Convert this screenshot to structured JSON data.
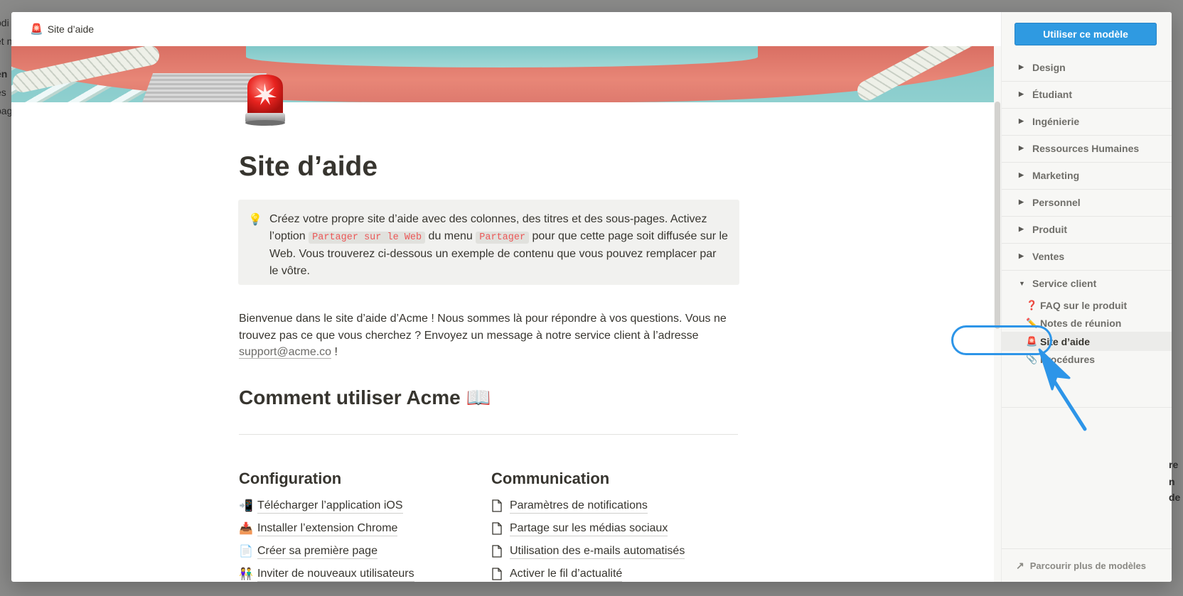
{
  "page": {
    "tab_title": "Site d’aide",
    "tab_emoji": "🚨",
    "title": "Site d’aide",
    "callout": {
      "emoji": "💡",
      "text_1": "Créez votre propre site d’aide avec des colonnes, des titres et des sous-pages. Activez l’option ",
      "code_1": "Partager sur le Web",
      "text_2": " du menu ",
      "code_2": "Partager",
      "text_3": " pour que cette page soit diffusée sur le Web. Vous trouverez ci-dessous un exemple de contenu que vous pouvez remplacer par le vôtre."
    },
    "intro": {
      "text": "Bienvenue dans le site d’aide d’Acme ! Nous sommes là pour répondre à vos questions. Vous ne trouvez pas ce que vous cherchez ? Envoyez un message à notre service client à l’adresse ",
      "email": "support@acme.co",
      "suffix": " !"
    },
    "section_heading": "Comment utiliser Acme 📖",
    "columns": [
      {
        "heading": "Configuration",
        "items": [
          {
            "icon": "📲",
            "label": "Télécharger l’application iOS"
          },
          {
            "icon": "📥",
            "label": "Installer l’extension Chrome"
          },
          {
            "icon": "📄",
            "label": "Créer sa première page"
          },
          {
            "icon": "👫",
            "label": "Inviter de nouveaux utilisateurs"
          }
        ]
      },
      {
        "heading": "Communication",
        "items": [
          {
            "icon": "page-icon",
            "label": "Paramètres de notifications"
          },
          {
            "icon": "page-icon",
            "label": "Partage sur les médias sociaux"
          },
          {
            "icon": "page-icon",
            "label": "Utilisation des e-mails automatisés"
          },
          {
            "icon": "page-icon",
            "label": "Activer le fil d’actualité"
          }
        ]
      }
    ]
  },
  "sidebar": {
    "use_button": "Utiliser ce modèle",
    "categories": [
      {
        "label": "Design",
        "expanded": false
      },
      {
        "label": "Étudiant",
        "expanded": false
      },
      {
        "label": "Ingénierie",
        "expanded": false
      },
      {
        "label": "Ressources Humaines",
        "expanded": false
      },
      {
        "label": "Marketing",
        "expanded": false
      },
      {
        "label": "Personnel",
        "expanded": false
      },
      {
        "label": "Produit",
        "expanded": false
      },
      {
        "label": "Ventes",
        "expanded": false
      },
      {
        "label": "Service client",
        "expanded": true
      }
    ],
    "subitems": [
      {
        "emoji": "❓",
        "label": "FAQ sur le produit",
        "active": false
      },
      {
        "emoji": "✏️",
        "label": "Notes de réunion",
        "active": false
      },
      {
        "emoji": "🚨",
        "label": "Site d’aide",
        "active": true
      },
      {
        "emoji": "📎",
        "label": "Procédures",
        "active": false
      }
    ],
    "footer": "Parcourir plus de modèles"
  },
  "colors": {
    "accent": "#2f9ae1",
    "highlight": "#2d95e8",
    "code_text": "#eb5757"
  }
}
